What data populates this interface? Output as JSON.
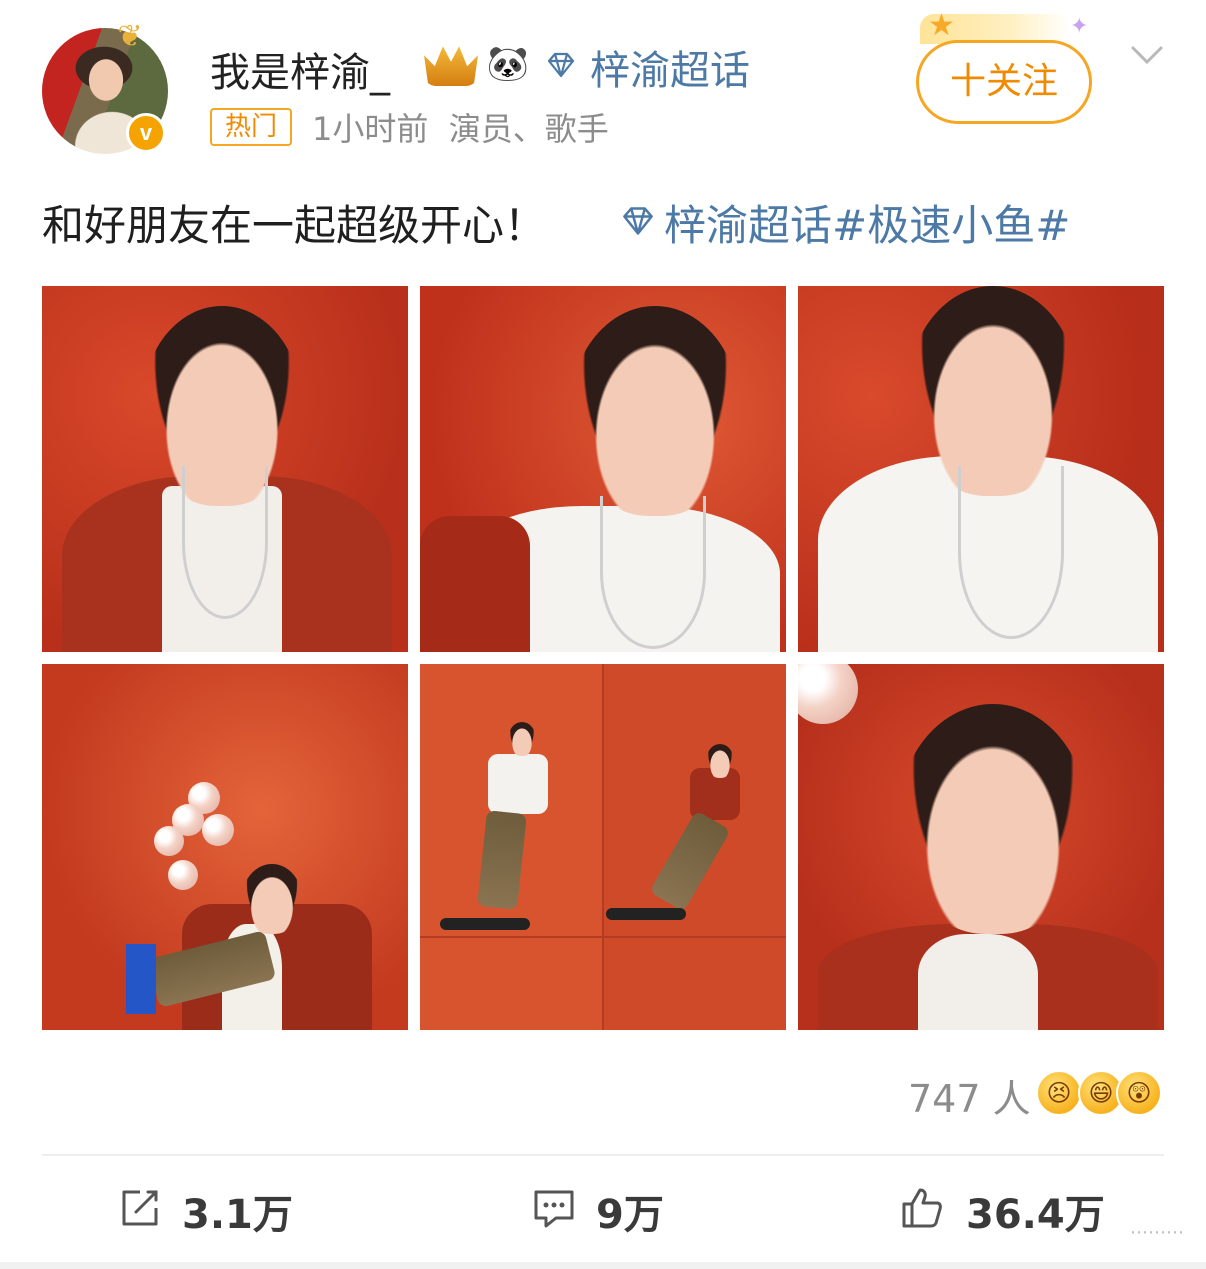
{
  "post": {
    "author": "我是梓渝_",
    "super_topic_label": "梓渝超话",
    "follow_label": "十关注",
    "hot_badge": "热门",
    "time": "1小时前",
    "author_desc": "演员、歌手",
    "text": "和好朋友在一起超级开心！",
    "topic_link": "梓渝超话#极速小鱼#",
    "photos": [
      {
        "name": "photo-1"
      },
      {
        "name": "photo-2"
      },
      {
        "name": "photo-3"
      },
      {
        "name": "photo-4"
      },
      {
        "name": "photo-5"
      },
      {
        "name": "photo-6"
      }
    ],
    "reactions": {
      "count": "747 人",
      "emojis": [
        "😣",
        "😄",
        "😲"
      ]
    },
    "actions": {
      "repost": "3.1万",
      "comment": "9万",
      "like": "36.4万"
    },
    "watermark": "⋯⋯⋯"
  },
  "icons": {
    "verified": "v-badge",
    "super_topic": "diamond-icon",
    "more": "chevron-down-icon",
    "repost": "repost-icon",
    "comment": "comment-icon",
    "like": "thumbs-up-icon"
  },
  "colors": {
    "link_blue": "#4c79a6",
    "accent_orange": "#f08a00",
    "photo_red": "#c8301e"
  }
}
